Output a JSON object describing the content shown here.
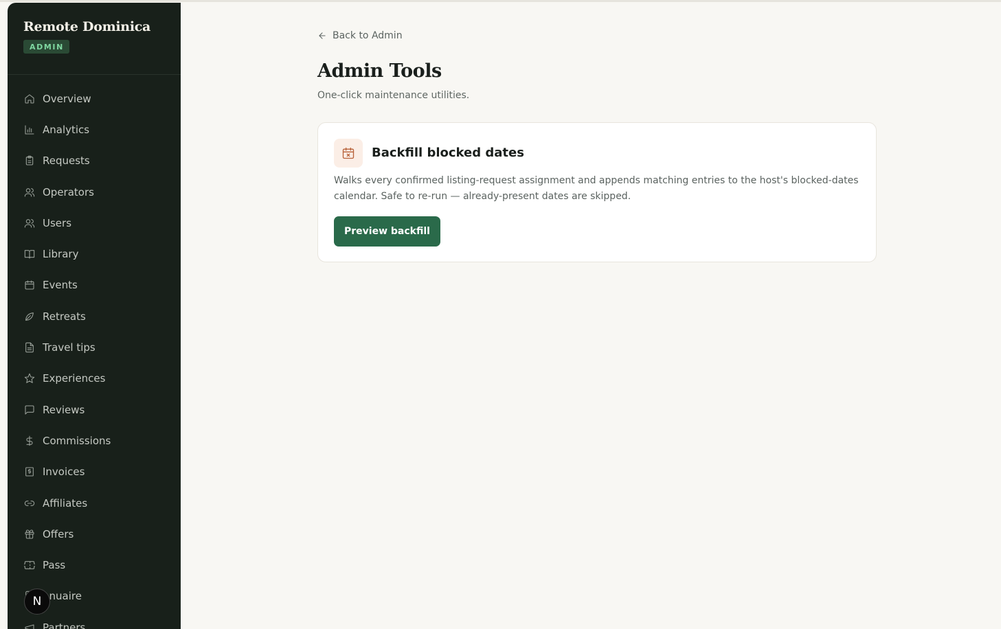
{
  "brand": {
    "title": "Remote Dominica",
    "badge": "ADMIN"
  },
  "sidebar": {
    "items": [
      {
        "label": "Overview",
        "icon": "home-icon"
      },
      {
        "label": "Analytics",
        "icon": "bar-chart-icon"
      },
      {
        "label": "Requests",
        "icon": "clipboard-icon"
      },
      {
        "label": "Operators",
        "icon": "users-icon"
      },
      {
        "label": "Users",
        "icon": "users-icon"
      },
      {
        "label": "Library",
        "icon": "book-open-icon"
      },
      {
        "label": "Events",
        "icon": "calendar-icon"
      },
      {
        "label": "Retreats",
        "icon": "leaf-icon"
      },
      {
        "label": "Travel tips",
        "icon": "file-text-icon"
      },
      {
        "label": "Experiences",
        "icon": "star-icon"
      },
      {
        "label": "Reviews",
        "icon": "message-square-icon"
      },
      {
        "label": "Commissions",
        "icon": "dollar-sign-icon"
      },
      {
        "label": "Invoices",
        "icon": "receipt-icon"
      },
      {
        "label": "Affiliates",
        "icon": "link-icon"
      },
      {
        "label": "Offers",
        "icon": "gift-icon"
      },
      {
        "label": "Pass",
        "icon": "ticket-icon"
      },
      {
        "label": "nnuaire",
        "icon": "directory-icon"
      },
      {
        "label": "Partners",
        "icon": "megaphone-icon"
      }
    ],
    "fab_label": "N"
  },
  "main": {
    "back_label": "Back to Admin",
    "title": "Admin Tools",
    "subtitle": "One-click maintenance utilities.",
    "card": {
      "icon": "calendar-x-icon",
      "title": "Backfill blocked dates",
      "description": "Walks every confirmed listing-request assignment and appends matching entries to the host's blocked-dates calendar. Safe to re-run — already-present dates are skipped.",
      "button_label": "Preview backfill"
    }
  },
  "colors": {
    "sidebar_bg": "#18201a",
    "badge_text": "#7fd6a0",
    "primary_button": "#2a6a4a",
    "page_bg": "#f8f7f3"
  }
}
